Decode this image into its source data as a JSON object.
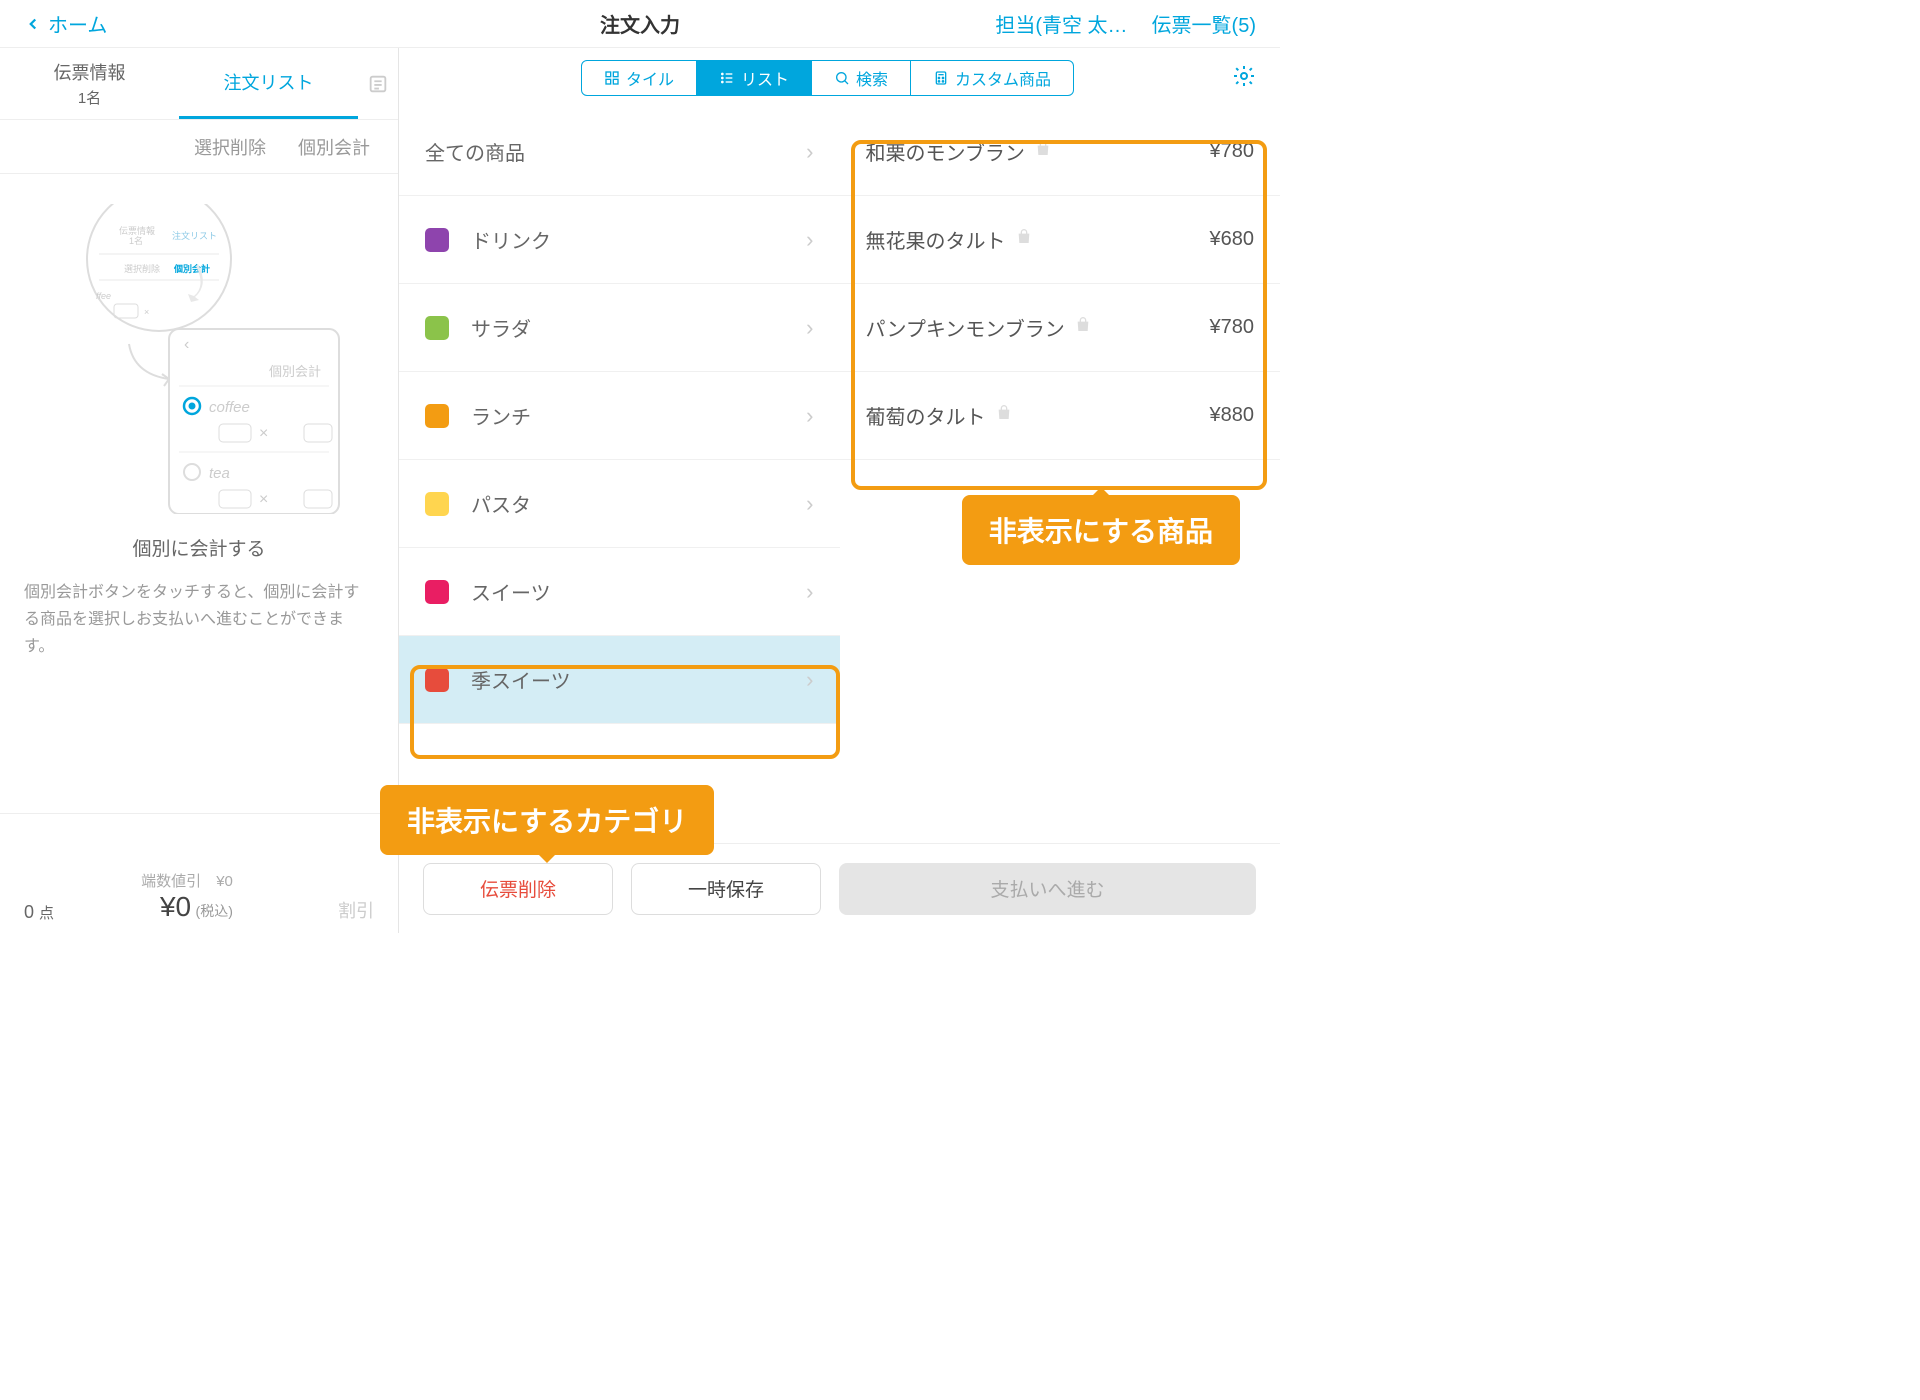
{
  "header": {
    "home": "ホーム",
    "title": "注文入力",
    "staff": "担当(青空 太…",
    "slips": "伝票一覧(5)"
  },
  "side": {
    "tab1": "伝票情報",
    "tab1sub": "1名",
    "tab2": "注文リスト",
    "delSel": "選択削除",
    "split": "個別会計",
    "illTitle": "個別に会計する",
    "illDesc": "個別会計ボタンをタッチすると、個別に会計する商品を選択しお支払いへ進むことができます。",
    "points": "0",
    "ptsUnit": "点",
    "round": "端数値引",
    "roundVal": "¥0",
    "total": "¥0",
    "tax": "(税込)",
    "disc": "割引"
  },
  "segs": {
    "tile": "タイル",
    "list": "リスト",
    "search": "検索",
    "custom": "カスタム商品"
  },
  "categories": [
    {
      "name": "全ての商品",
      "color": null
    },
    {
      "name": "ドリンク",
      "color": "#8e44ad"
    },
    {
      "name": "サラダ",
      "color": "#8bc34a"
    },
    {
      "name": "ランチ",
      "color": "#f39c12"
    },
    {
      "name": "パスタ",
      "color": "#ffd54f"
    },
    {
      "name": "スイーツ",
      "color": "#e91e63"
    },
    {
      "name": "季スイーツ",
      "color": "#e74c3c",
      "selected": true
    }
  ],
  "products": [
    {
      "name": "和栗のモンブラン",
      "price": "¥780"
    },
    {
      "name": "無花果のタルト",
      "price": "¥680"
    },
    {
      "name": "パンプキンモンブラン",
      "price": "¥780"
    },
    {
      "name": "葡萄のタルト",
      "price": "¥880"
    }
  ],
  "actions": {
    "delete": "伝票削除",
    "save": "一時保存",
    "pay": "支払いへ進む"
  },
  "callouts": {
    "products": "非表示にする商品",
    "category": "非表示にするカテゴリ"
  },
  "ill": {
    "t1": "伝票情報",
    "t2": "1名",
    "t3": "注文リスト",
    "t4": "選択削除",
    "t5": "個別会計",
    "t6": "ffee",
    "t7": "個別会計",
    "t8": "coffee",
    "t9": "tea"
  }
}
